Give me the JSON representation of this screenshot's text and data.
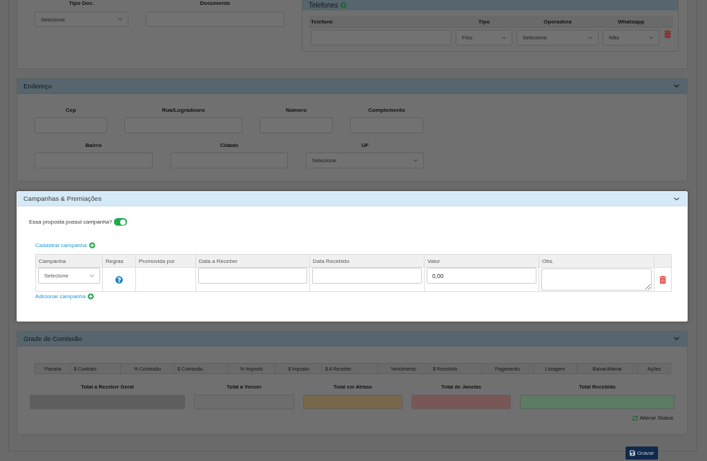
{
  "top_section": {
    "highlighted": false,
    "fields": [
      {
        "label": "Tipo Doc.",
        "kind": "select",
        "value": "Selecione"
      },
      {
        "label": "Documento",
        "kind": "input"
      }
    ],
    "phones": {
      "title": "Telefones",
      "columns": [
        "Telefone",
        "Tipo",
        "Operadora",
        "Whatsapp"
      ],
      "rows": [
        {
          "cells": [
            {
              "kind": "input"
            },
            {
              "kind": "select",
              "value": "Fixo"
            },
            {
              "kind": "select",
              "value": "Selecione"
            },
            {
              "kind": "select",
              "value": "Não"
            }
          ]
        }
      ]
    }
  },
  "address_section": {
    "title": "Endereço",
    "highlighted": false,
    "field_rows": [
      {
        "fields": [
          {
            "label": "Cep",
            "kind": "input"
          },
          {
            "label": "Rua/Logradouro",
            "kind": "input"
          },
          {
            "label": "Número",
            "kind": "input"
          },
          {
            "label": "Complemento",
            "kind": "input"
          }
        ]
      },
      {
        "fields": [
          {
            "label": "Bairro",
            "kind": "input"
          },
          {
            "label": "Cidade",
            "kind": "input"
          },
          {
            "label": "UF",
            "kind": "select",
            "value": "Selecione"
          }
        ]
      }
    ]
  },
  "campaign_section": {
    "title": "Campanhas & Premiações",
    "highlighted": true,
    "has_campaign": {
      "label": "Essa proposta possui campanha?",
      "on": true
    },
    "register_link": "Cadastrar campanha",
    "table": {
      "columns": [
        "Campanha",
        "Regras",
        "Promovida por",
        "Data a Receber",
        "Data Recebido",
        "Valor",
        "Obs."
      ],
      "rows": [
        {
          "cells": [
            {
              "kind": "select",
              "value": "Selecione"
            },
            {
              "kind": "help"
            },
            {
              "kind": "blank"
            },
            {
              "kind": "input"
            },
            {
              "kind": "input"
            },
            {
              "kind": "input",
              "value": "0,00"
            },
            {
              "kind": "textarea"
            }
          ]
        }
      ]
    },
    "add_link": "Adicionar campanha"
  },
  "commission_section": {
    "title": "Grade de Comissão",
    "highlighted": false,
    "columns": [
      "Parcela",
      "$ Contrato",
      "% Comissão",
      "$ Comissão",
      "% Imposto",
      "$ Imposto",
      "$ A Receber",
      "Vencimento",
      "$ Recebido",
      "Pagamento",
      "Listagem",
      "Baixar/Alterar",
      "Ações"
    ],
    "totals": [
      {
        "label": "Total a Receber Geral",
        "color": "#5e5e5e"
      },
      {
        "label": "Total a Vencer",
        "color": "#6d6d6d"
      },
      {
        "label": "Total em Atraso",
        "color": "#77684c"
      },
      {
        "label": "Total de Janelas",
        "color": "#7a5757"
      },
      {
        "label": "Total Recebido",
        "color": "#5d7a63"
      }
    ],
    "status_link": "Alterar Status"
  },
  "save_button": {
    "label": "Gravar"
  }
}
